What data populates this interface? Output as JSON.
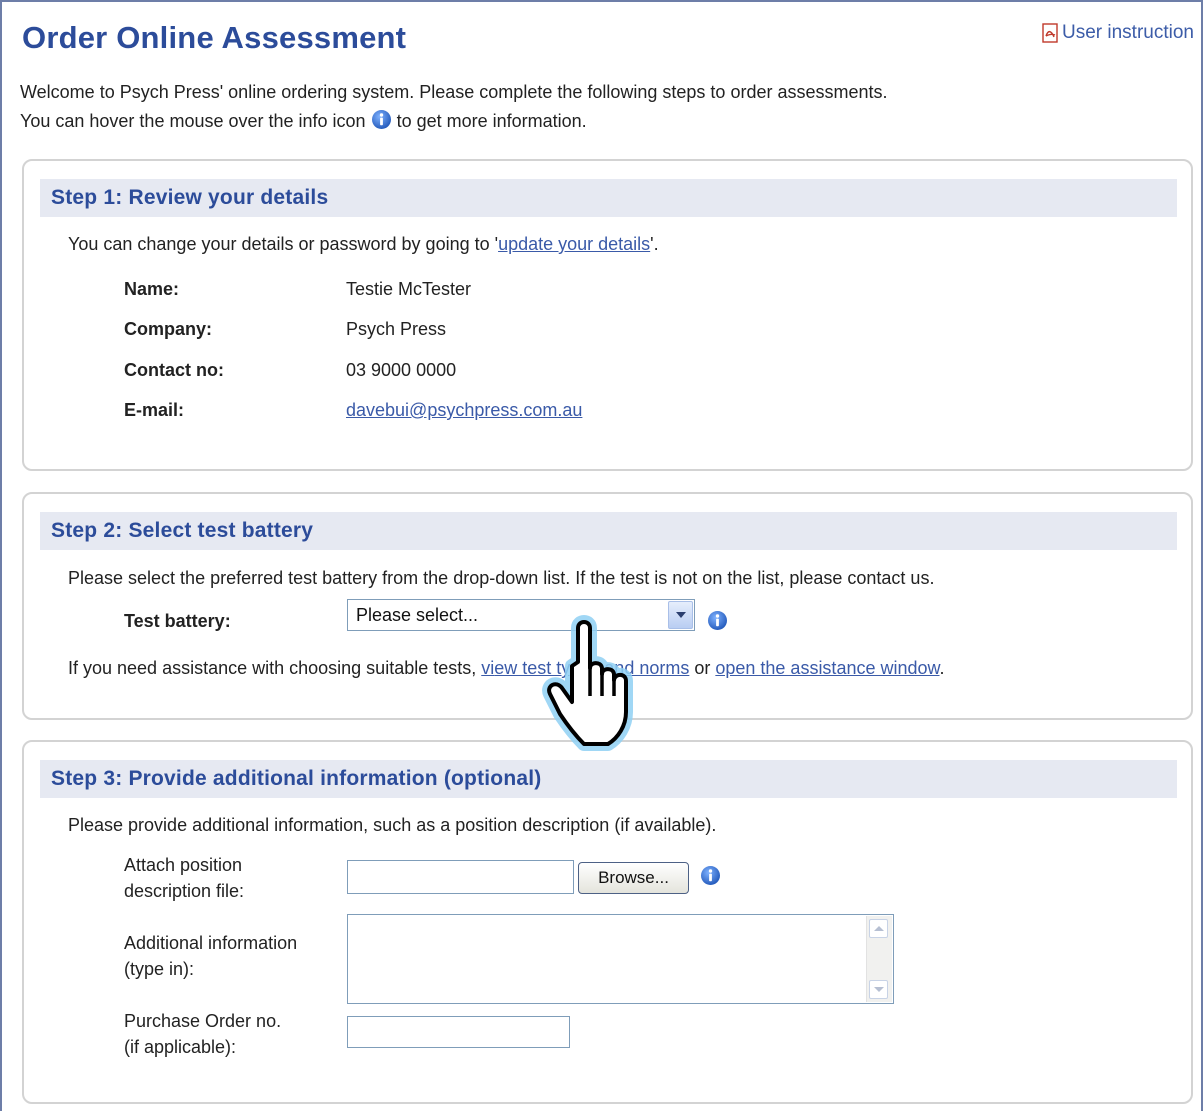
{
  "header": {
    "title": "Order Online Assessment",
    "user_instruction": "User instruction"
  },
  "intro": {
    "line1": "Welcome to Psych Press' online ordering system. Please complete the following steps to order assessments.",
    "line2_before": "You can hover the mouse over the info icon",
    "line2_after": "to get more information."
  },
  "step1": {
    "title": "Step 1: Review your details",
    "text_before": "You can change your details or password by going to '",
    "link": "update your details",
    "text_after": "'.",
    "details": [
      {
        "label": "Name:",
        "value": "Testie McTester"
      },
      {
        "label": "Company:",
        "value": "Psych Press"
      },
      {
        "label": "Contact no:",
        "value": "03 9000 0000"
      },
      {
        "label": "E-mail:",
        "value": "davebui@psychpress.com.au"
      }
    ]
  },
  "step2": {
    "title": "Step 2: Select test battery",
    "instruction": "Please select the preferred test battery from the drop-down list. If the test is not on the list, please contact us.",
    "label": "Test battery:",
    "selected": "Please select...",
    "help_before": "If you need assistance with choosing suitable tests, ",
    "help_mid1": "vi",
    "link1": "ew test types and norms",
    "help_or": " or ",
    "link2": "open the assistance window",
    "help_end": "."
  },
  "step3": {
    "title": "Step 3: Provide additional information (optional)",
    "instruction": "Please provide additional information, such as a position description (if available).",
    "attach_label_1": "Attach position",
    "attach_label_2": "description file:",
    "browse": "Browse...",
    "addinfo_label_1": "Additional information",
    "addinfo_label_2": "(type in):",
    "po_label_1": "Purchase Order no.",
    "po_label_2": "(if applicable):"
  },
  "colors": {
    "title": "#2c4c9a",
    "header_bg": "#e6e9f2",
    "link": "#3a5aa8",
    "info_icon": "#2f66c9"
  },
  "icons": [
    "pdf-icon",
    "info-icon",
    "hand-cursor-icon"
  ]
}
